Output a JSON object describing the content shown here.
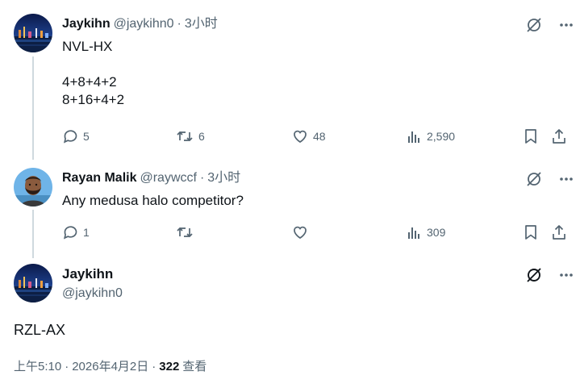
{
  "tweets": [
    {
      "display_name": "Jaykihn",
      "handle": "@jaykihn0",
      "dot": "·",
      "time": "3小时",
      "lines": [
        "NVL-HX",
        "",
        "4+8+4+2",
        "8+16+4+2"
      ],
      "replies": "5",
      "retweets": "6",
      "likes": "48",
      "views": "2,590"
    },
    {
      "display_name": "Rayan Malik",
      "handle": "@raywccf",
      "dot": "·",
      "time": "3小时",
      "lines": [
        "Any medusa halo competitor?"
      ],
      "replies": "1",
      "retweets": "",
      "likes": "",
      "views": "309"
    }
  ],
  "main": {
    "display_name": "Jaykihn",
    "handle": "@jaykihn0",
    "text": "RZL-AX",
    "time": "上午5:10",
    "date": "2026年4月2日",
    "sep": "·",
    "views_count": "322",
    "views_label": "查看"
  },
  "icons": {
    "grok": "grok-icon",
    "more": "more-icon",
    "reply": "reply-icon",
    "retweet": "retweet-icon",
    "like": "like-icon",
    "views": "views-icon",
    "bookmark": "bookmark-icon",
    "share": "share-icon"
  },
  "colors": {
    "text": "#0f1419",
    "secondary": "#536471",
    "thread_line": "#cfd9de"
  }
}
